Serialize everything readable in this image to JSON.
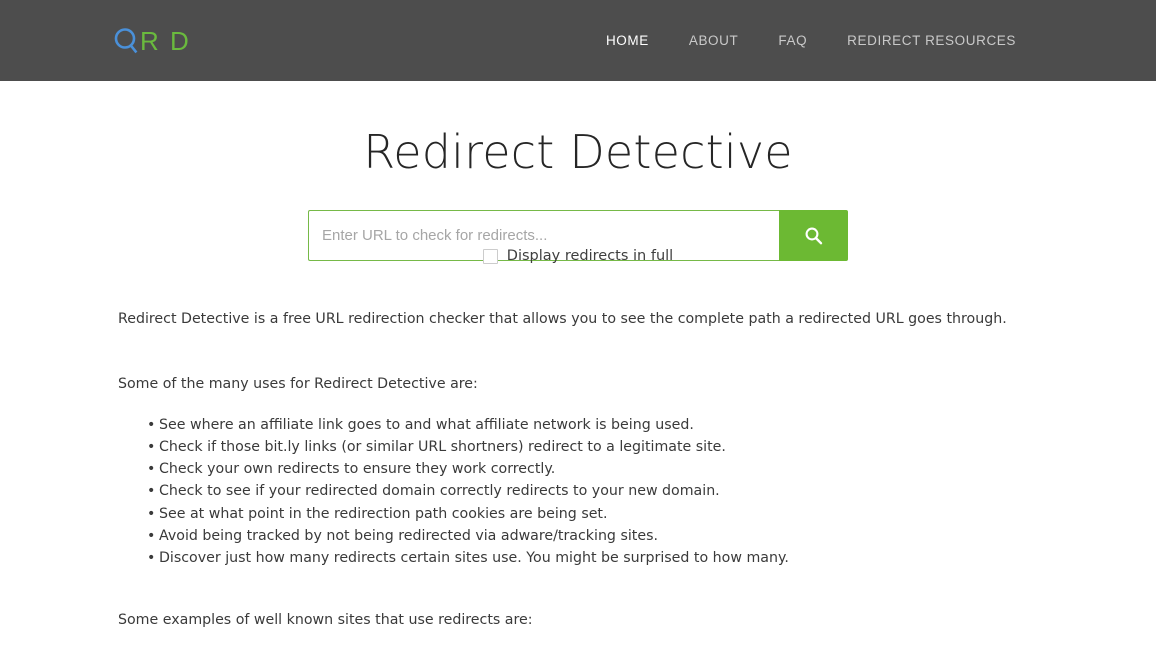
{
  "header": {
    "logo": {
      "mark_icon": "magnifier-q-icon",
      "mark_color": "#4a90d9",
      "letters": "R D",
      "letters_color": "#6aba3e"
    },
    "nav": [
      {
        "label": "HOME",
        "active": true
      },
      {
        "label": "ABOUT",
        "active": false
      },
      {
        "label": "FAQ",
        "active": false
      },
      {
        "label": "REDIRECT RESOURCES",
        "active": false
      }
    ],
    "background_color": "#4d4d4d"
  },
  "hero": {
    "title": "Redirect Detective",
    "search": {
      "value": "",
      "placeholder": "Enter URL to check for redirects...",
      "button_icon": "search-icon",
      "button_color": "#6cb933",
      "border_color": "#76b947"
    },
    "checkbox": {
      "label": "Display redirects in full",
      "checked": false
    }
  },
  "content": {
    "intro": "Redirect Detective is a free URL redirection checker that allows you to see the complete path a redirected URL goes through.",
    "uses_lead": "Some of the many uses for Redirect Detective are:",
    "uses": [
      "See where an affiliate link goes to and what affiliate network is being used.",
      "Check if those bit.ly links (or similar URL shortners) redirect to a legitimate site.",
      "Check your own redirects to ensure they work correctly.",
      "Check to see if your redirected domain correctly redirects to your new domain.",
      "See at what point in the redirection path cookies are being set.",
      "Avoid being tracked by not being redirected via adware/tracking sites.",
      "Discover just how many redirects certain sites use. You might be surprised to how many."
    ],
    "examples_lead": "Some examples of well known sites that use redirects are:"
  }
}
